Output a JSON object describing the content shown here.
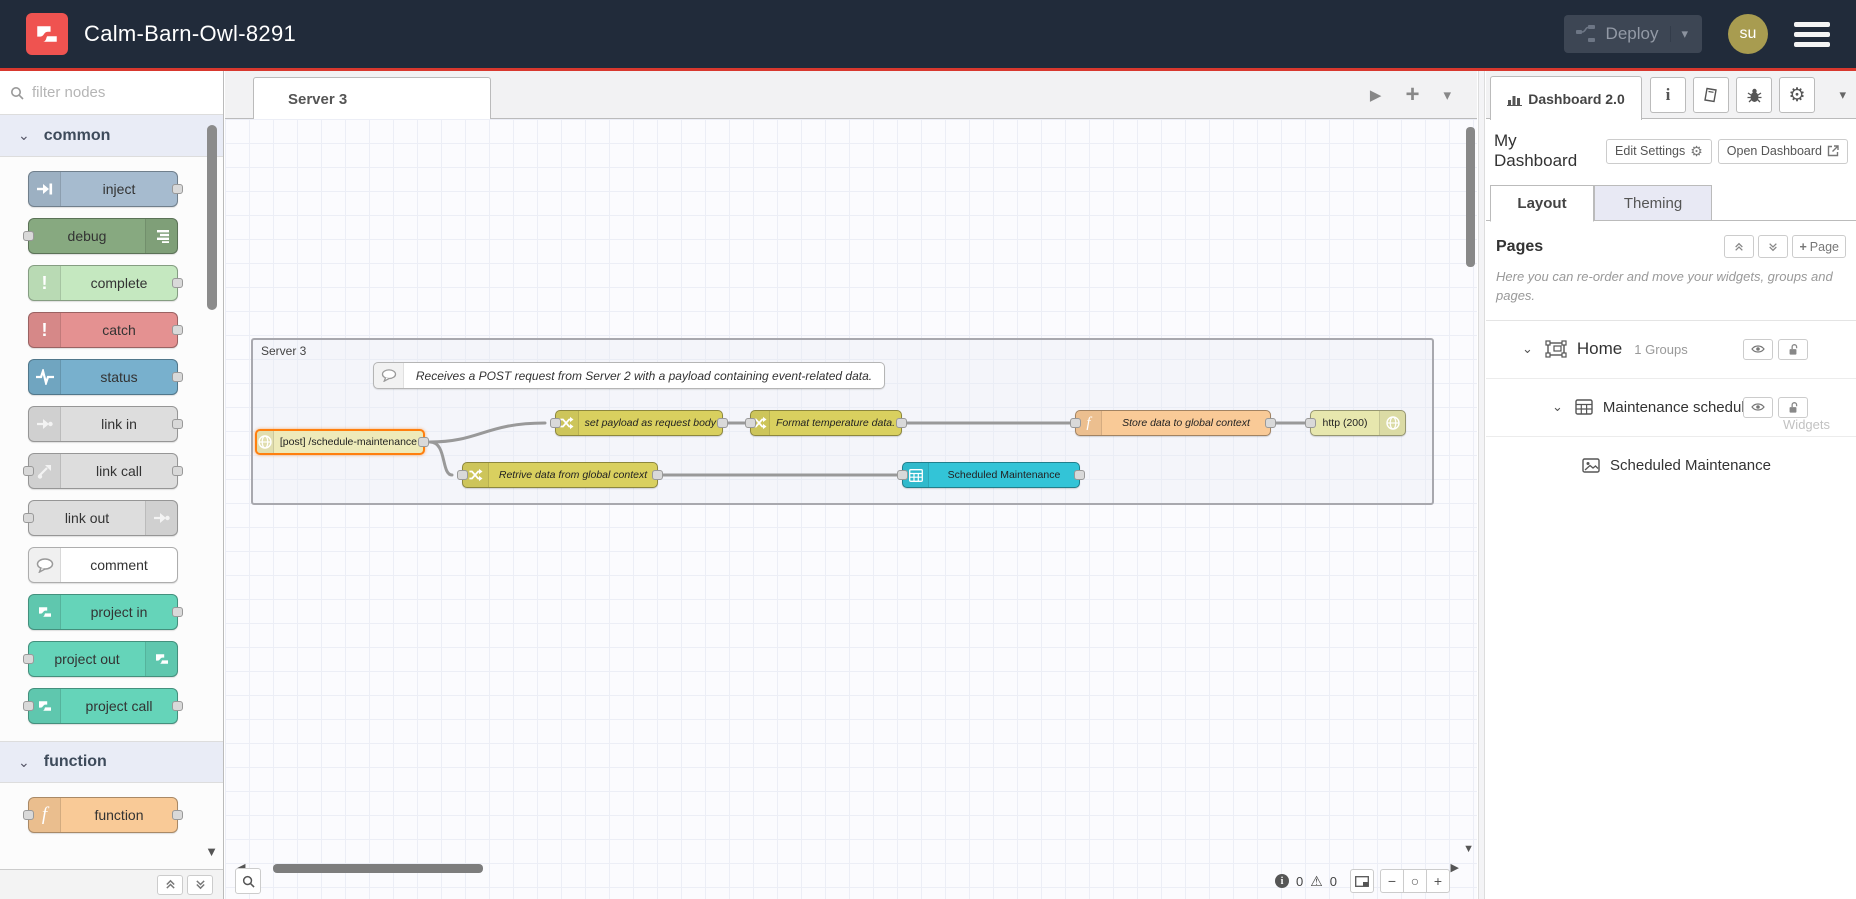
{
  "colors": {
    "accent_red": "#d8382e",
    "header_bg": "#212b3a",
    "selected_node_border": "#ff7f0e",
    "wire": "#999999"
  },
  "icons": {
    "chevron_down": "⌄",
    "caret_down": "▾",
    "play": "▶",
    "plus": "+",
    "scroll_left": "◀",
    "scroll_right": "▶",
    "scroll_down": "▼",
    "gear": "⚙",
    "warning": "⚠",
    "minus": "−",
    "circle": "○",
    "info": "i"
  },
  "header": {
    "title": "Calm-Barn-Owl-8291",
    "deploy_label": "Deploy",
    "avatar_initials": "su"
  },
  "palette": {
    "filter_placeholder": "filter nodes",
    "categories": [
      {
        "label": "common",
        "nodes": [
          {
            "label": "inject",
            "color": "#a6bbcf"
          },
          {
            "label": "debug",
            "color": "#87a980"
          },
          {
            "label": "complete",
            "color": "#c5e8c0"
          },
          {
            "label": "catch",
            "color": "#e49191"
          },
          {
            "label": "status",
            "color": "#78b0cd"
          },
          {
            "label": "link in",
            "color": "#dddddd"
          },
          {
            "label": "link call",
            "color": "#dddddd"
          },
          {
            "label": "link out",
            "color": "#dddddd"
          },
          {
            "label": "comment",
            "color": "#ffffff"
          },
          {
            "label": "project in",
            "color": "#65d4b9"
          },
          {
            "label": "project out",
            "color": "#65d4b9"
          },
          {
            "label": "project call",
            "color": "#65d4b9"
          }
        ]
      },
      {
        "label": "function",
        "nodes": [
          {
            "label": "function",
            "color": "#f9ca97"
          }
        ]
      }
    ]
  },
  "workspace": {
    "tab": "Server 3",
    "group_label": "Server 3",
    "comment_text": "Receives a POST request from Server 2 with a payload containing event-related data.",
    "nodes": [
      {
        "label": "[post] /schedule-maintenance",
        "color": "#eeeab9"
      },
      {
        "label": "set payload as request body",
        "color": "#d9d05f"
      },
      {
        "label": "Format temperature data.",
        "color": "#d9d05f"
      },
      {
        "label": "Store data to global context",
        "color": "#f9ca97"
      },
      {
        "label": "http (200)",
        "color": "#e7e7ae"
      },
      {
        "label": "Retrive data from global context",
        "color": "#d9d05f"
      },
      {
        "label": "Scheduled Maintenance",
        "color": "#33c4d7"
      }
    ],
    "status": {
      "errors": "0",
      "warnings": "0"
    }
  },
  "sidebar": {
    "tab": "Dashboard 2.0",
    "dashboard_name": "My Dashboard",
    "edit_settings_label": "Edit Settings",
    "open_dashboard_label": "Open Dashboard",
    "tabs": [
      {
        "label": "Layout"
      },
      {
        "label": "Theming"
      }
    ],
    "pages_title": "Pages",
    "add_page_label": "Page",
    "help_text": "Here you can re-order and move your widgets, groups and pages.",
    "tree": [
      {
        "label": "Home",
        "meta": "1 Groups"
      },
      {
        "label": "Maintenance schedul...",
        "ghost": "Widgets"
      },
      {
        "label": "Scheduled Maintenance"
      }
    ]
  }
}
